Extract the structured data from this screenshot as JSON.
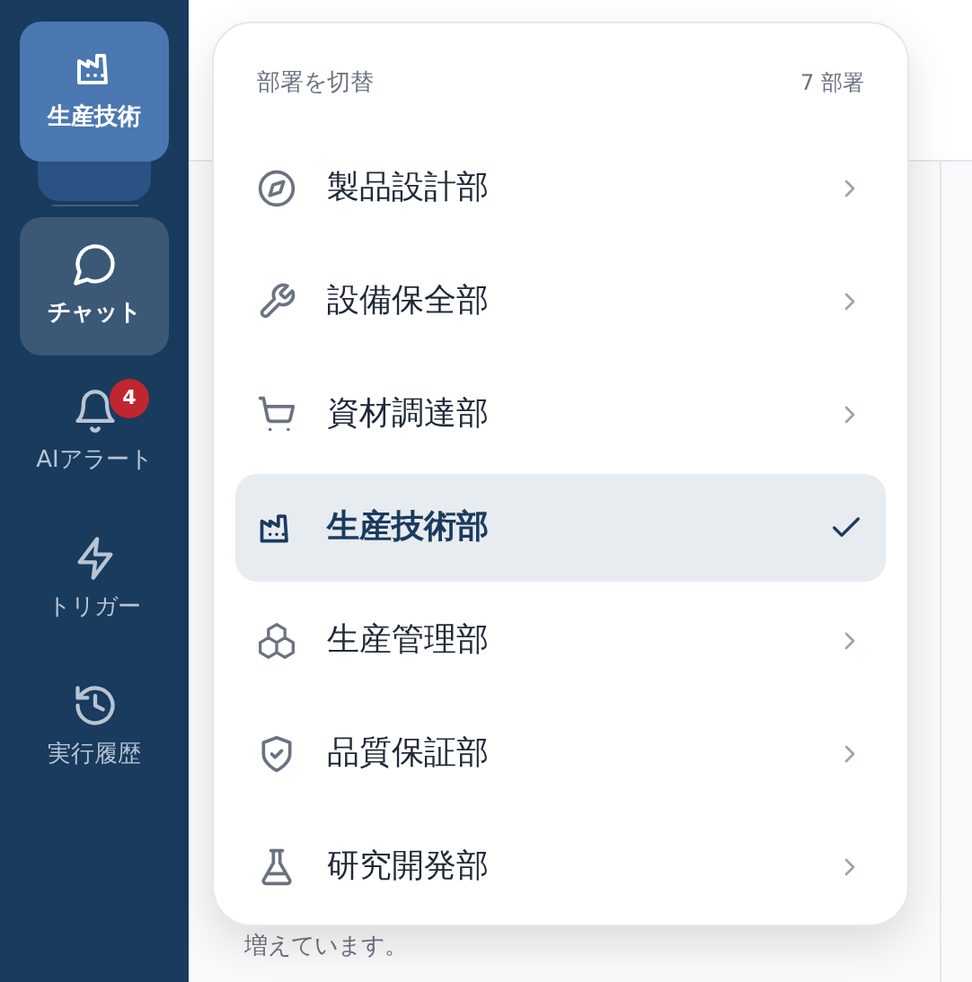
{
  "sidebar": {
    "department_button": {
      "label": "生産技術"
    },
    "items": [
      {
        "label": "チャット",
        "selected": true
      },
      {
        "label": "AIアラート",
        "selected": false,
        "badge": "4"
      },
      {
        "label": "トリガー",
        "selected": false
      },
      {
        "label": "実行履歴",
        "selected": false
      }
    ]
  },
  "main": {
    "visible_text": "増えています。"
  },
  "department_menu": {
    "title": "部署を切替",
    "count": "7 部署",
    "departments": [
      {
        "label": "製品設計部",
        "selected": false
      },
      {
        "label": "設備保全部",
        "selected": false
      },
      {
        "label": "資材調達部",
        "selected": false
      },
      {
        "label": "生産技術部",
        "selected": true
      },
      {
        "label": "生産管理部",
        "selected": false
      },
      {
        "label": "品質保証部",
        "selected": false
      },
      {
        "label": "研究開発部",
        "selected": false
      }
    ]
  }
}
